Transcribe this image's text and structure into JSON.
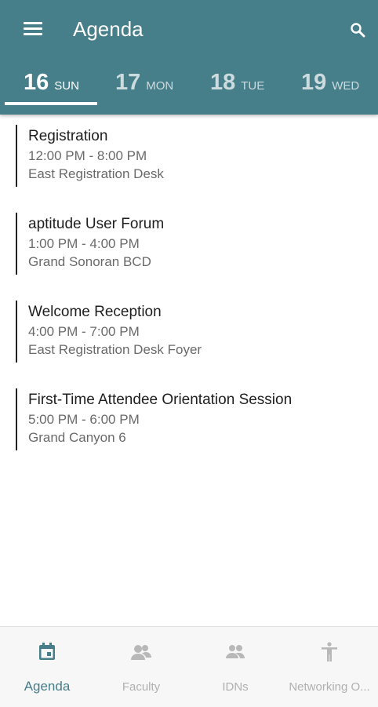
{
  "header": {
    "title": "Agenda",
    "background": "#467e8a",
    "menu_icon": "hamburger-menu-icon",
    "search_icon": "search-icon"
  },
  "days": [
    {
      "day": "16",
      "dow": "SUN",
      "selected": true
    },
    {
      "day": "17",
      "dow": "MON",
      "selected": false
    },
    {
      "day": "18",
      "dow": "TUE",
      "selected": false
    },
    {
      "day": "19",
      "dow": "WED",
      "selected": false
    }
  ],
  "sessions": [
    {
      "title": "Registration",
      "time": "12:00 PM - 8:00 PM",
      "location": "East Registration Desk"
    },
    {
      "title": "aptitude User Forum",
      "time": "1:00 PM - 4:00 PM",
      "location": "Grand Sonoran BCD"
    },
    {
      "title": "Welcome Reception",
      "time": "4:00 PM - 7:00 PM",
      "location": "East Registration Desk Foyer"
    },
    {
      "title": "First-Time Attendee Orientation Session",
      "time": "5:00 PM - 6:00 PM",
      "location": "Grand Canyon 6"
    }
  ],
  "bottom_nav": [
    {
      "label": "Agenda",
      "icon": "calendar-icon",
      "active": true
    },
    {
      "label": "Faculty",
      "icon": "faculty-icon",
      "active": false
    },
    {
      "label": "IDNs",
      "icon": "people-icon",
      "active": false
    },
    {
      "label": "Networking O...",
      "icon": "person-standing-icon",
      "active": false
    }
  ],
  "colors": {
    "accent": "#467e8a",
    "inactive_nav": "#b0b0b0"
  }
}
